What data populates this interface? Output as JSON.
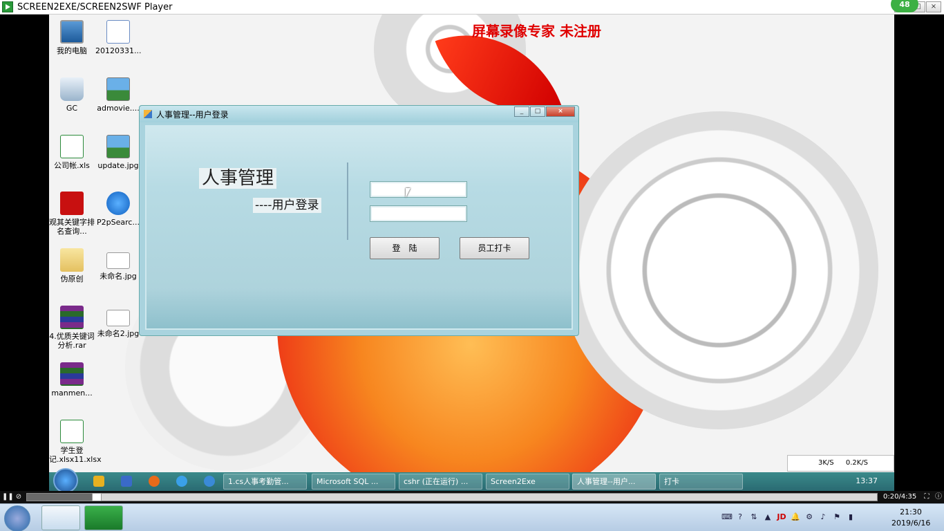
{
  "player": {
    "title": "SCREEN2EXE/SCREEN2SWF Player",
    "badge": "48",
    "time": "0:20/4:35"
  },
  "watermark": "屏幕录像专家  未注册",
  "desktop_icons": [
    {
      "label": "我的电脑",
      "icon": "computer-icon"
    },
    {
      "label": "20120331...",
      "icon": "document-icon"
    },
    {
      "label": "GC",
      "icon": "recycle-bin-icon"
    },
    {
      "label": "admovie....",
      "icon": "image-file-icon"
    },
    {
      "label": "公司帐.xls",
      "icon": "excel-file-icon"
    },
    {
      "label": "update.jpg",
      "icon": "image-file-icon"
    },
    {
      "label": "观其关键字排名查询...",
      "icon": "flash-icon"
    },
    {
      "label": "P2pSearc...",
      "icon": "p2p-search-icon"
    },
    {
      "label": "伪原创",
      "icon": "folder-icon"
    },
    {
      "label": "未命名.jpg",
      "icon": "image-file-icon"
    },
    {
      "label": "4.优质关键词分析.rar",
      "icon": "rar-archive-icon"
    },
    {
      "label": "未命名2.jpg",
      "icon": "image-file-icon"
    },
    {
      "label": "manmen...",
      "icon": "rar-archive-icon"
    },
    {
      "label": "学生登记.xlsx11.xlsx",
      "icon": "excel-file-icon"
    }
  ],
  "dialog": {
    "title": "人事管理--用户登录",
    "heading": "人事管理",
    "subheading": "----用户登录",
    "username_value": "",
    "password_value": "",
    "login_button": "登　陆",
    "clockin_button": "员工打卡"
  },
  "recorded_taskbar": {
    "tasks": [
      {
        "label": "1.cs人事考勤管..."
      },
      {
        "label": "Microsoft SQL ..."
      },
      {
        "label": "cshr (正在运行) ..."
      },
      {
        "label": "Screen2Exe"
      },
      {
        "label": "人事管理--用户..."
      },
      {
        "label": "打卡"
      }
    ],
    "clock": "13:37",
    "net_down": "3K/S",
    "net_up": "0.2K/S"
  },
  "host_taskbar": {
    "time": "21:30",
    "date": "2019/6/16"
  }
}
